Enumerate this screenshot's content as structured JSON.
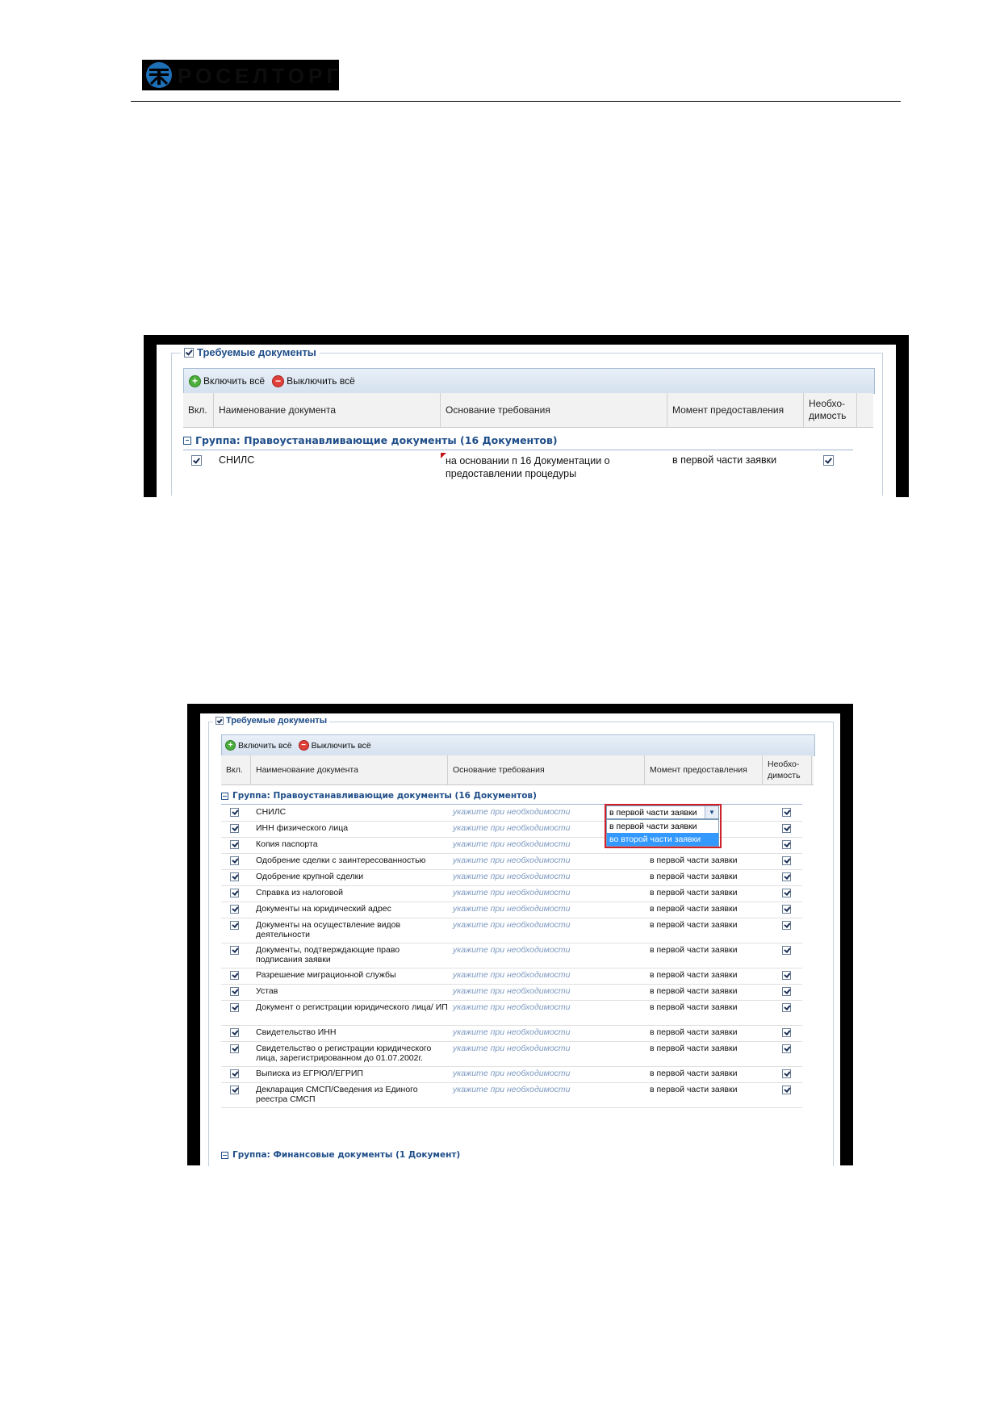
{
  "logo": {
    "text": "РОСЕЛТОРГ"
  },
  "screen1": {
    "legend": "Требуемые документы",
    "toolbar": {
      "enable_all": "Включить всё",
      "disable_all": "Выключить всё"
    },
    "columns": [
      "Вкл.",
      "Наименование документа",
      "Основание требования",
      "Момент предоставления",
      "Необхо-\nдимость"
    ],
    "group": "Группа: Правоустанавливающие документы (16 Документов)",
    "row": {
      "name": "СНИЛС",
      "basis": "на основании п 16 Документации о предоставлении процедуры",
      "moment": "в первой части заявки"
    }
  },
  "screen2": {
    "legend": "Требуемые документы",
    "toolbar": {
      "enable_all": "Включить всё",
      "disable_all": "Выключить всё"
    },
    "columns": [
      "Вкл.",
      "Наименование документа",
      "Основание требования",
      "Момент предоставления",
      "Необхо-\nдимость"
    ],
    "group": "Группа: Правоустанавливающие документы (16 Документов)",
    "group2": "Группа: Финансовые документы (1 Документ)",
    "basis_hint": "укажите при необходимости",
    "dropdown": {
      "selected": "в первой части заявки",
      "options": [
        "в первой части заявки",
        "во второй части заявки"
      ]
    },
    "rows": [
      {
        "name": "СНИЛС",
        "moment": ""
      },
      {
        "name": "ИНН физического лица",
        "moment": ""
      },
      {
        "name": "Копия паспорта",
        "moment": ""
      },
      {
        "name": "Одобрение сделки с заинтересованностью",
        "moment": "в первой части заявки"
      },
      {
        "name": "Одобрение крупной сделки",
        "moment": "в первой части заявки"
      },
      {
        "name": "Справка из налоговой",
        "moment": "в первой части заявки"
      },
      {
        "name": "Документы на юридический адрес",
        "moment": "в первой части заявки"
      },
      {
        "name": "Документы на осуществление видов деятельности",
        "moment": "в первой части заявки"
      },
      {
        "name": "Документы, подтверждающие право подписания заявки",
        "moment": "в первой части заявки"
      },
      {
        "name": "Разрешение миграционной службы",
        "moment": "в первой части заявки"
      },
      {
        "name": "Устав",
        "moment": "в первой части заявки"
      },
      {
        "name": "Документ о регистрации юридического лица/ ИП",
        "moment": "в первой части заявки"
      },
      {
        "name": "Свидетельство ИНН",
        "moment": "в первой части заявки"
      },
      {
        "name": "Свидетельство о регистрации юридического лица, зарегистрированном до 01.07.2002г.",
        "moment": "в первой части заявки"
      },
      {
        "name": "Выписка из ЕГРЮЛ/ЕГРИП",
        "moment": "в первой части заявки"
      },
      {
        "name": "Декларация СМСП/Сведения из Единого реестра СМСП",
        "moment": "в первой части заявки"
      }
    ]
  },
  "colors": {
    "accent": "#1f4e89",
    "hint": "#7b98bf",
    "highlight_border": "#d0202a",
    "selection": "#3399ff"
  }
}
